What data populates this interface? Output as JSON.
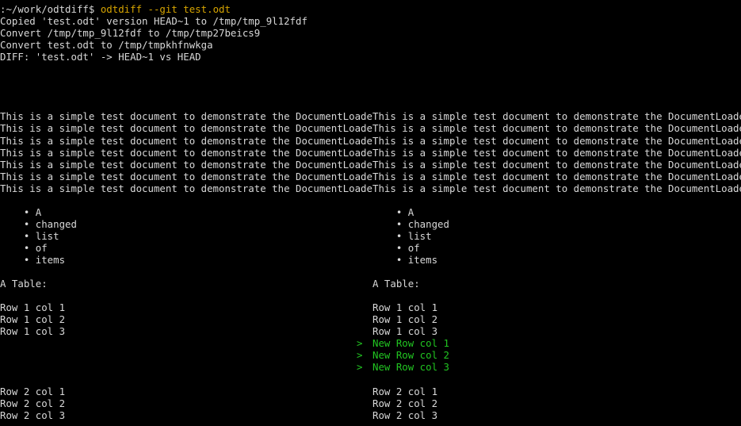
{
  "terminal": {
    "background_color": "#000000",
    "default_text_color": "#d8d8d8",
    "command_color": "#d6a400",
    "added_color": "#21c521",
    "columns": 126,
    "rows": 35
  },
  "header": {
    "prompt": ":~/work/odtdiff$ ",
    "command": "odtdiff --git test.odt",
    "log_lines": [
      "Copied 'test.odt' version HEAD~1 to /tmp/tmp_9l12fdf",
      "Convert /tmp/tmp_9l12fdf to /tmp/tmp27beics9",
      "Convert test.odt to /tmp/tmpkhfnwkga",
      "DIFF: 'test.odt' -> HEAD~1 vs HEAD"
    ]
  },
  "diff": {
    "left_title": "HEAD~1",
    "right_title": "HEAD",
    "marker_added": ">",
    "rows": [
      {
        "left": "",
        "marker": "",
        "right": ""
      },
      {
        "left": "",
        "marker": "",
        "right": ""
      },
      {
        "left": "",
        "marker": "",
        "right": ""
      },
      {
        "left": "",
        "marker": "",
        "right": ""
      },
      {
        "left": "This is a simple test document to demonstrate the DocumentLoade",
        "marker": "",
        "right": "This is a simple test document to demonstrate the DocumentLoade"
      },
      {
        "left": "This is a simple test document to demonstrate the DocumentLoade",
        "marker": "",
        "right": "This is a simple test document to demonstrate the DocumentLoade"
      },
      {
        "left": "This is a simple test document to demonstrate the DocumentLoade",
        "marker": "",
        "right": "This is a simple test document to demonstrate the DocumentLoade"
      },
      {
        "left": "This is a simple test document to demonstrate the DocumentLoade",
        "marker": "",
        "right": "This is a simple test document to demonstrate the DocumentLoade"
      },
      {
        "left": "This is a simple test document to demonstrate the DocumentLoade",
        "marker": "",
        "right": "This is a simple test document to demonstrate the DocumentLoade"
      },
      {
        "left": "This is a simple test document to demonstrate the DocumentLoade",
        "marker": "",
        "right": "This is a simple test document to demonstrate the DocumentLoade"
      },
      {
        "left": "This is a simple test document to demonstrate the DocumentLoade",
        "marker": "",
        "right": "This is a simple test document to demonstrate the DocumentLoade"
      },
      {
        "left": "",
        "marker": "",
        "right": ""
      },
      {
        "left": "    • A",
        "marker": "",
        "right": "    • A"
      },
      {
        "left": "    • changed",
        "marker": "",
        "right": "    • changed"
      },
      {
        "left": "    • list",
        "marker": "",
        "right": "    • list"
      },
      {
        "left": "    • of",
        "marker": "",
        "right": "    • of"
      },
      {
        "left": "    • items",
        "marker": "",
        "right": "    • items"
      },
      {
        "left": "",
        "marker": "",
        "right": ""
      },
      {
        "left": "A Table:",
        "marker": "",
        "right": "A Table:"
      },
      {
        "left": "",
        "marker": "",
        "right": ""
      },
      {
        "left": "Row 1 col 1",
        "marker": "",
        "right": "Row 1 col 1"
      },
      {
        "left": "Row 1 col 2",
        "marker": "",
        "right": "Row 1 col 2"
      },
      {
        "left": "Row 1 col 3",
        "marker": "",
        "right": "Row 1 col 3"
      },
      {
        "left": "",
        "marker": ">",
        "right": "New Row col 1",
        "added": true
      },
      {
        "left": "",
        "marker": ">",
        "right": "New Row col 2",
        "added": true
      },
      {
        "left": "",
        "marker": ">",
        "right": "New Row col 3",
        "added": true
      },
      {
        "left": "",
        "marker": "",
        "right": ""
      },
      {
        "left": "Row 2 col 1",
        "marker": "",
        "right": "Row 2 col 1"
      },
      {
        "left": "Row 2 col 2",
        "marker": "",
        "right": "Row 2 col 2"
      },
      {
        "left": "Row 2 col 3",
        "marker": "",
        "right": "Row 2 col 3"
      }
    ]
  }
}
